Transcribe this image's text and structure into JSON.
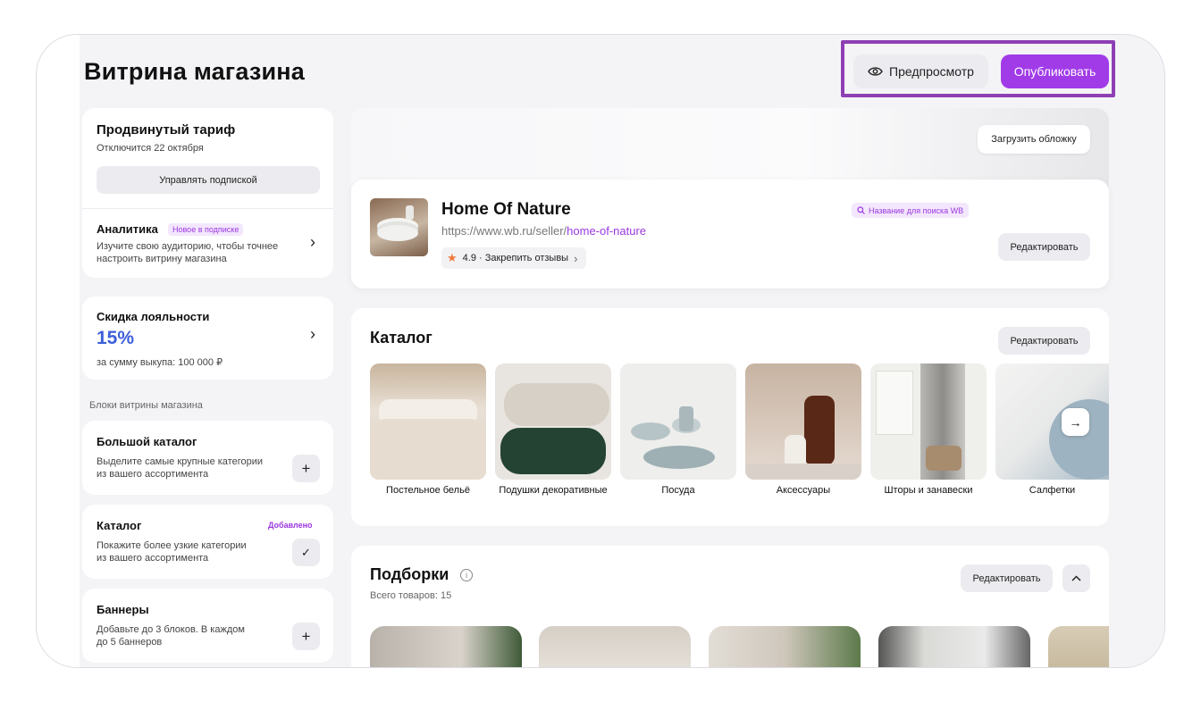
{
  "page": {
    "title": "Витрина магазина"
  },
  "header": {
    "preview_label": "Предпросмотр",
    "publish_label": "Опубликовать"
  },
  "colors": {
    "accent": "#a13be8",
    "highlight_box": "#8f3fb4",
    "discount": "#3d5fd9",
    "star": "#f07a3a"
  },
  "sidebar": {
    "tariff": {
      "title": "Продвинутый тариф",
      "subtitle": "Отключится 22 октября",
      "manage_label": "Управлять подпиской"
    },
    "analytics": {
      "title": "Аналитика",
      "badge": "Новое в подписке",
      "description_line1": "Изучите свою аудиторию, чтобы точнее",
      "description_line2": "настроить витрину магазина"
    },
    "loyalty": {
      "title": "Скидка лояльности",
      "value": "15%",
      "subtitle": "за сумму выкупа: 100 000 ₽"
    },
    "blocks_label": "Блоки витрины магазина",
    "blocks": [
      {
        "title": "Большой каталог",
        "line1": "Выделите самые крупные категории",
        "line2": "из вашего ассортимента",
        "action": "+"
      },
      {
        "title": "Каталог",
        "badge": "Добавлено",
        "line1": "Покажите более узкие категории",
        "line2": "из вашего ассортимента",
        "action": "✓"
      },
      {
        "title": "Баннеры",
        "line1": "Добавьте до 3 блоков. В каждом",
        "line2": "до 5 баннеров",
        "action": "+"
      }
    ]
  },
  "cover": {
    "upload_label": "Загрузить обложку"
  },
  "store": {
    "name": "Home Of Nature",
    "url_prefix": "https://www.wb.ru/seller/",
    "url_slug": "home-of-nature",
    "rating": "4.9 · Закрепить отзывы",
    "search_tag": "Название для поиска WB",
    "edit_label": "Редактировать"
  },
  "catalog": {
    "title": "Каталог",
    "edit_label": "Редактировать",
    "items": [
      {
        "label": "Постельное бельё"
      },
      {
        "label": "Подушки декоративные"
      },
      {
        "label": "Посуда"
      },
      {
        "label": "Аксессуары"
      },
      {
        "label": "Шторы и занавески"
      },
      {
        "label": "Салфетки"
      }
    ]
  },
  "selections": {
    "title": "Подборки",
    "count": "Всего товаров: 15",
    "edit_label": "Редактировать"
  }
}
